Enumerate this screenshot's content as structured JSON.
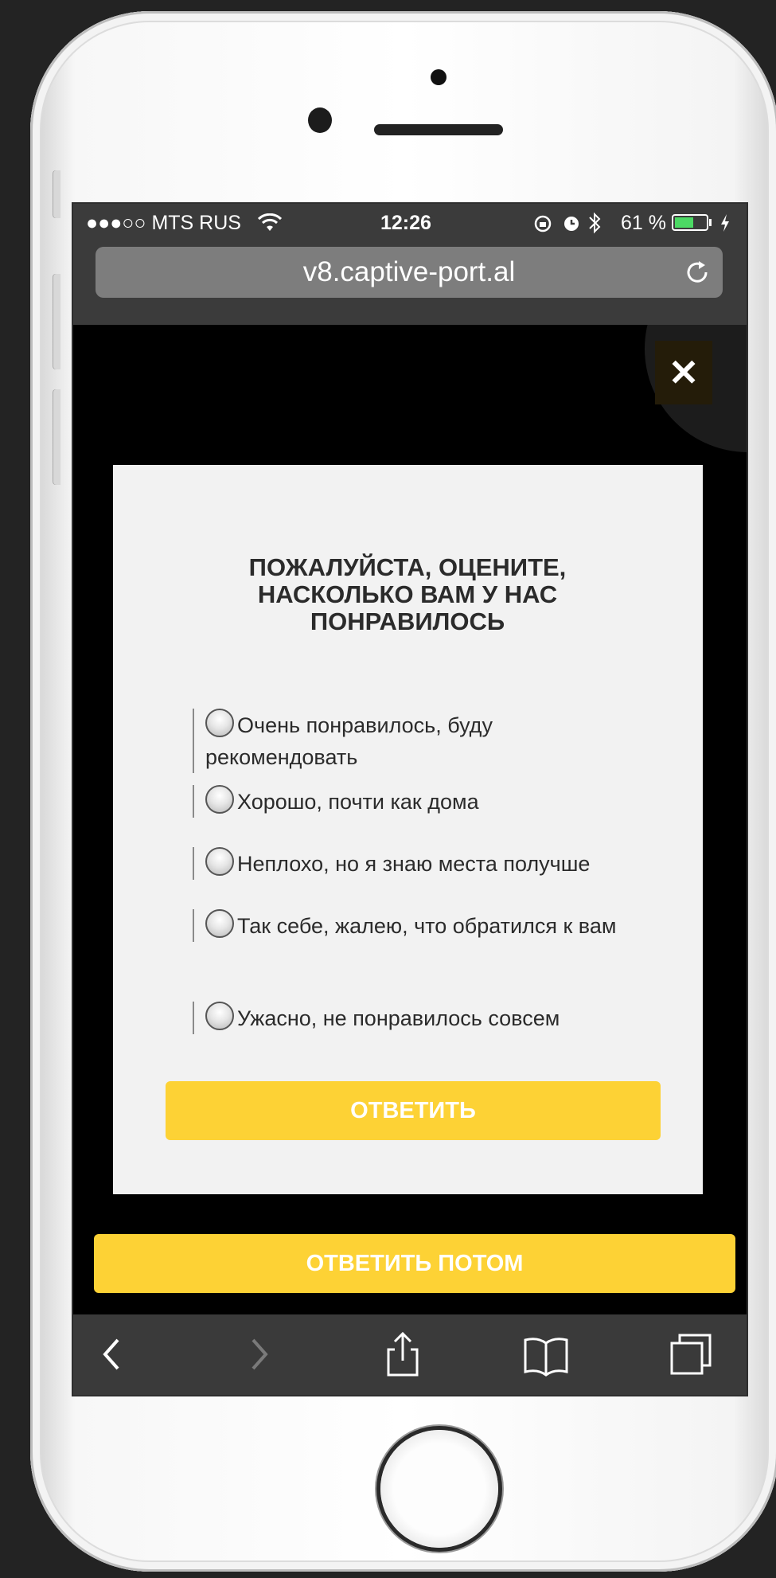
{
  "status_bar": {
    "carrier": "●●●○○ MTS RUS",
    "time": "12:26",
    "battery_percent": "61 %",
    "battery_level": 0.61,
    "battery_color": "#4cd964"
  },
  "browser": {
    "url": "v8.captive-port.al"
  },
  "modal": {
    "title": "ПОЖАЛУЙСТА, ОЦЕНИТЕ, НАСКОЛЬКО ВАМ У НАС ПОНРАВИЛОСЬ",
    "options": [
      {
        "label": "Очень понравилось, буду рекомендовать"
      },
      {
        "label": "Хорошо, почти как дома"
      },
      {
        "label": "Неплохо, но я знаю места получше"
      },
      {
        "label": "Так себе, жалею, что обратился к вам"
      },
      {
        "label": "Ужасно, не понравилось совсем"
      }
    ],
    "submit_label": "ОТВЕТИТЬ"
  },
  "later_button_label": "ОТВЕТИТЬ ПОТОМ",
  "close_icon": "✕",
  "accent_color": "#fdd235",
  "toolbar_icons": [
    "back-icon",
    "forward-icon",
    "share-icon",
    "bookmarks-icon",
    "tabs-icon"
  ]
}
